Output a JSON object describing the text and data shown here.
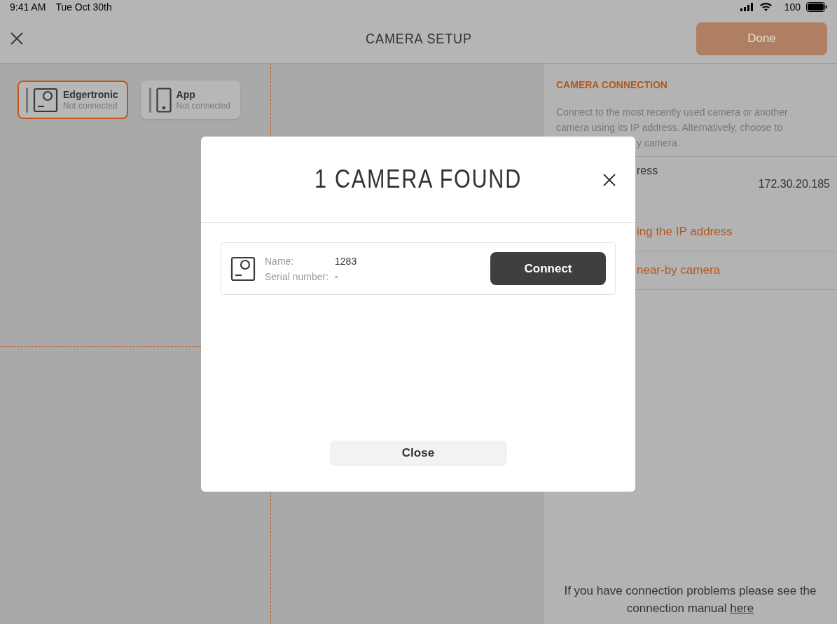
{
  "status_bar": {
    "time": "9:41 AM",
    "date": "Tue Oct 30th",
    "battery": "100"
  },
  "header": {
    "title": "CAMERA SETUP",
    "done_button": "Done",
    "done_disabled": true
  },
  "devices": [
    {
      "name": "Edgertronic",
      "status": "Not connected",
      "kind": "camera",
      "selected": true
    },
    {
      "name": "App",
      "status": "Not connected",
      "kind": "phone",
      "selected": false
    }
  ],
  "panel": {
    "heading": "CAMERA CONNECTION",
    "description": "Connect to the most recently used camera or another camera using its IP address. Alternatively, choose to",
    "description_tail": "y camera.",
    "rows": [
      {
        "label": "ress",
        "value": "172.30.20.185",
        "kind": "field"
      },
      {
        "label": "ing the IP address",
        "kind": "link"
      },
      {
        "label": "near-by camera",
        "kind": "link"
      }
    ],
    "footer": "If you have connection problems please see the connection manual",
    "footer_link": "here"
  },
  "dialog": {
    "title": "1 CAMERA FOUND",
    "cameras": [
      {
        "name_label": "Name:",
        "name": "1283",
        "serial_label": "Serial number:",
        "serial": "-",
        "button": "Connect"
      }
    ],
    "close_button": "Close"
  }
}
